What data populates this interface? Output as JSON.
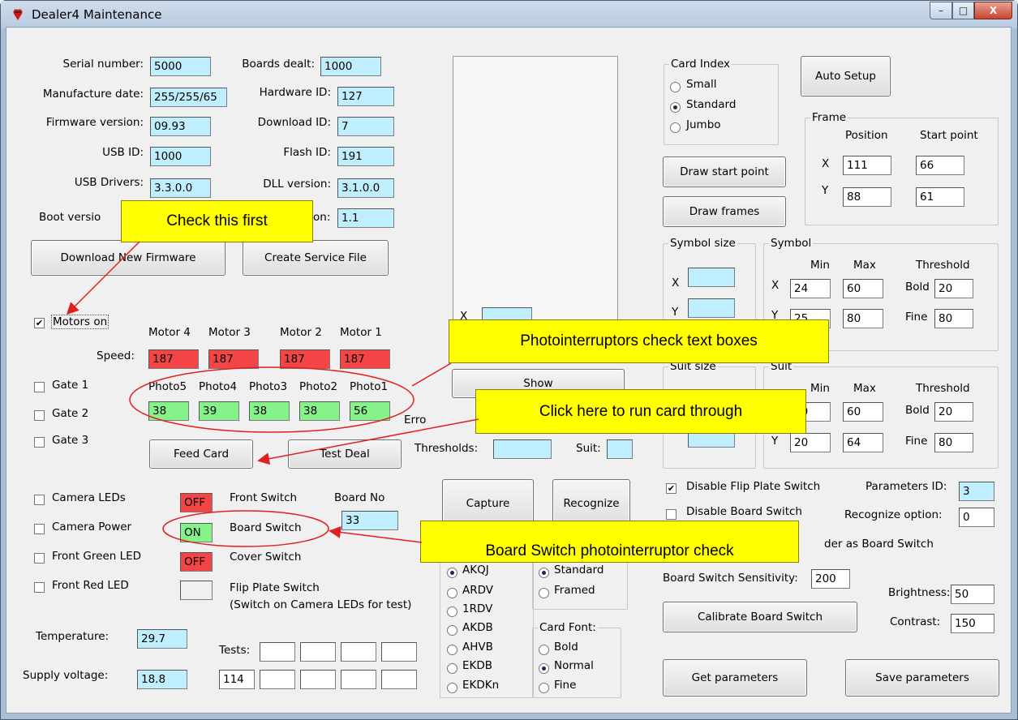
{
  "window": {
    "title": "Dealer4 Maintenance",
    "controls": {
      "minimize": "–",
      "maximize": "□",
      "close": "X"
    }
  },
  "info": {
    "serial_label": "Serial number:",
    "serial": "5000",
    "mfg_label": "Manufacture date:",
    "mfg": "255/255/65",
    "fw_label": "Firmware version:",
    "fw": "09.93",
    "usbid_label": "USB ID:",
    "usbid": "1000",
    "drivers_label": "USB Drivers:",
    "drivers": "3.3.0.0",
    "boot_label": "Boot versio",
    "boards_label": "Boards dealt:",
    "boards": "1000",
    "hw_label": "Hardware ID:",
    "hw": "127",
    "dl_label": "Download ID:",
    "dl": "7",
    "flash_label": "Flash ID:",
    "flash": "191",
    "dll_label": "DLL version:",
    "dll": "3.1.0.0",
    "on_label": "on:",
    "on_value": "1.1"
  },
  "buttons": {
    "download": "Download New Firmware",
    "service": "Create Service File",
    "feed": "Feed Card",
    "test_deal": "Test Deal",
    "capture": "Capture",
    "recognize": "Recognize",
    "show": "Show",
    "auto_setup": "Auto Setup",
    "draw_start": "Draw start point",
    "draw_frames": "Draw frames",
    "calibrate": "Calibrate Board Switch",
    "get_params": "Get parameters",
    "save_params": "Save parameters"
  },
  "motors": {
    "on_label": "Motors on",
    "on_checked": true,
    "speed_label": "Speed:",
    "names": [
      "Motor 4",
      "Motor 3",
      "Motor 2",
      "Motor 1"
    ],
    "speeds": [
      "187",
      "187",
      "187",
      "187"
    ],
    "speed_color": "#f34545"
  },
  "gates": [
    "Gate 1",
    "Gate 2",
    "Gate 3"
  ],
  "photos": {
    "names": [
      "Photo5",
      "Photo4",
      "Photo3",
      "Photo2",
      "Photo1"
    ],
    "values": [
      "38",
      "39",
      "38",
      "38",
      "56"
    ],
    "color": "#86f28a"
  },
  "middle": {
    "x_label": "X",
    "err_label": "Erro",
    "thresholds_label": "Thresholds:",
    "suit_label": "Suit:"
  },
  "leds": [
    "Camera LEDs",
    "Camera Power",
    "Front Green LED",
    "Front Red LED"
  ],
  "switches": {
    "front": {
      "state": "OFF",
      "label": "Front Switch"
    },
    "board": {
      "state": "ON",
      "label": "Board Switch"
    },
    "cover": {
      "state": "OFF",
      "label": "Cover Switch"
    },
    "flip": {
      "label": "Flip Plate Switch",
      "note": "(Switch on Camera LEDs for test)"
    },
    "board_no_label": "Board No",
    "board_no": "33"
  },
  "temp": {
    "label": "Temperature:",
    "value": "29.7"
  },
  "voltage": {
    "label": "Supply voltage:",
    "value": "18.8"
  },
  "tests": {
    "label": "Tests:",
    "values": [
      "114"
    ]
  },
  "dealing": [
    "AKQJ",
    "ARDV",
    "1RDV",
    "AKDB",
    "AHVB",
    "EKDB",
    "EKDKn"
  ],
  "frame_style": [
    "Standard",
    "Framed"
  ],
  "card_font": {
    "title": "Card Font:",
    "options": [
      "Bold",
      "Normal",
      "Fine"
    ]
  },
  "card_index": {
    "title": "Card Index",
    "options": [
      "Small",
      "Standard",
      "Jumbo"
    ]
  },
  "frame": {
    "title": "Frame",
    "pos_label": "Position",
    "start_label": "Start point",
    "x_label": "X",
    "y_label": "Y",
    "x_pos": "111",
    "x_start": "66",
    "y_pos": "88",
    "y_start": "61"
  },
  "symbol_size": {
    "title": "Symbol size",
    "x_label": "X",
    "y_label": "Y"
  },
  "symbol": {
    "title": "Symbol",
    "min_label": "Min",
    "max_label": "Max",
    "thr_label": "Threshold",
    "x_label": "X",
    "y_label": "Y",
    "x_min": "24",
    "x_max": "60",
    "y_min": "25",
    "y_max": "80",
    "bold_label": "Bold",
    "bold": "20",
    "fine_label": "Fine",
    "fine": "80"
  },
  "suit_size": {
    "title": "Suit size"
  },
  "suit": {
    "title": "Suit",
    "min_label": "Min",
    "max_label": "Max",
    "thr_label": "Threshold",
    "x_min": "20",
    "x_max": "60",
    "y_min": "20",
    "y_max": "64",
    "bold_label": "Bold",
    "bold": "20",
    "fine_label": "Fine",
    "fine": "80",
    "y_label": "Y"
  },
  "options": {
    "disable_flip": "Disable Flip Plate Switch",
    "disable_flip_checked": true,
    "disable_board": "Disable Board Switch",
    "der_text": "der as Board Switch",
    "params_id_label": "Parameters ID:",
    "params_id": "3",
    "recognize_opt_label": "Recognize option:",
    "recognize_opt": "0",
    "sensitivity_label": "Board Switch Sensitivity:",
    "sensitivity": "200",
    "brightness_label": "Brightness:",
    "brightness": "50",
    "contrast_label": "Contrast:",
    "contrast": "150"
  },
  "callouts": [
    "Check this first",
    "Photointerruptors check text boxes",
    "Click here to run card through",
    "Board Switch photointerruptor check"
  ],
  "colors": {
    "callout": "#ffff00",
    "arrow": "#e02020"
  }
}
